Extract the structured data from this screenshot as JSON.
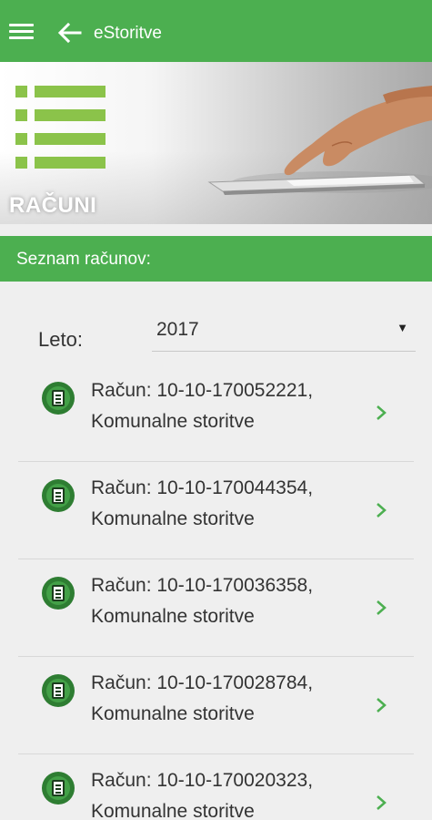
{
  "appbar": {
    "title": "eStoritve",
    "menu_icon": "hamburger-icon",
    "back_icon": "arrow-left-icon",
    "color": "#4caf50"
  },
  "banner": {
    "label": "RAČUNI"
  },
  "section": {
    "title": "Seznam računov:"
  },
  "filter": {
    "label": "Leto:",
    "selected": "2017"
  },
  "invoices": [
    {
      "title": "Račun: 10-10-170052221,",
      "subtitle": "Komunalne storitve"
    },
    {
      "title": "Račun: 10-10-170044354,",
      "subtitle": "Komunalne storitve"
    },
    {
      "title": "Račun: 10-10-170036358,",
      "subtitle": "Komunalne storitve"
    },
    {
      "title": "Račun: 10-10-170028784,",
      "subtitle": "Komunalne storitve"
    },
    {
      "title": "Račun: 10-10-170020323,",
      "subtitle": "Komunalne storitve"
    }
  ],
  "accent_color": "#4caf50",
  "chevron_color": "#4caf50"
}
